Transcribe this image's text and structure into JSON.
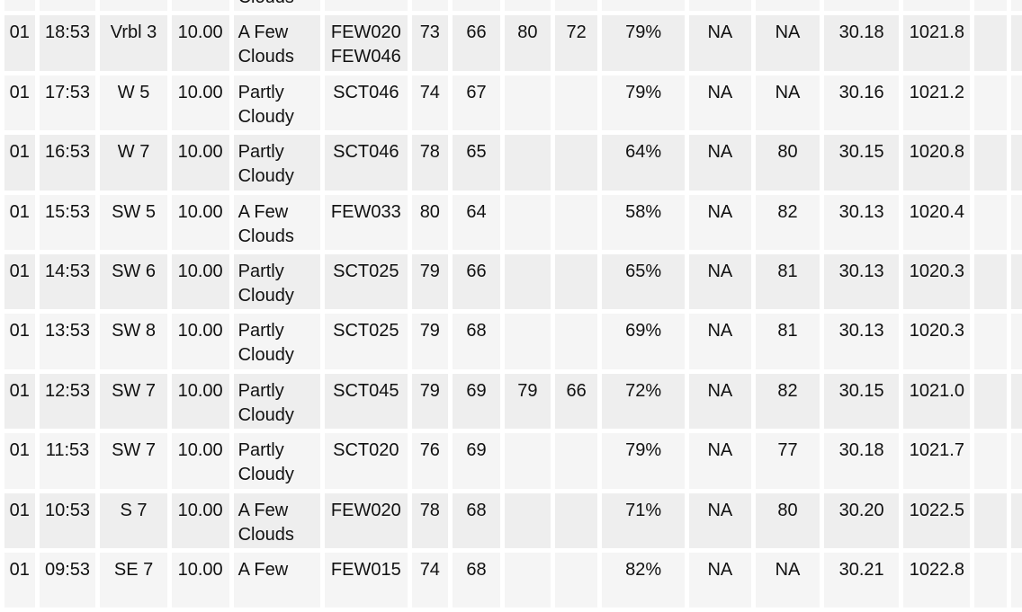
{
  "rows": [
    {
      "date": "",
      "time": "",
      "wind": "",
      "vis": "",
      "weather": "Clouds",
      "sky": "",
      "temp": "",
      "dew": "",
      "max6": "",
      "min6": "",
      "humidity": "",
      "windchill": "",
      "heatindex": "",
      "altimeter": "",
      "slp": "",
      "partial_top": true
    },
    {
      "date": "01",
      "time": "18:53",
      "wind": "Vrbl 3",
      "vis": "10.00",
      "weather": "A Few Clouds",
      "sky": "FEW020 FEW046",
      "temp": "73",
      "dew": "66",
      "max6": "80",
      "min6": "72",
      "humidity": "79%",
      "windchill": "NA",
      "heatindex": "NA",
      "altimeter": "30.18",
      "slp": "1021.8"
    },
    {
      "date": "01",
      "time": "17:53",
      "wind": "W 5",
      "vis": "10.00",
      "weather": "Partly Cloudy",
      "sky": "SCT046",
      "temp": "74",
      "dew": "67",
      "max6": "",
      "min6": "",
      "humidity": "79%",
      "windchill": "NA",
      "heatindex": "NA",
      "altimeter": "30.16",
      "slp": "1021.2"
    },
    {
      "date": "01",
      "time": "16:53",
      "wind": "W 7",
      "vis": "10.00",
      "weather": "Partly Cloudy",
      "sky": "SCT046",
      "temp": "78",
      "dew": "65",
      "max6": "",
      "min6": "",
      "humidity": "64%",
      "windchill": "NA",
      "heatindex": "80",
      "altimeter": "30.15",
      "slp": "1020.8"
    },
    {
      "date": "01",
      "time": "15:53",
      "wind": "SW 5",
      "vis": "10.00",
      "weather": "A Few Clouds",
      "sky": "FEW033",
      "temp": "80",
      "dew": "64",
      "max6": "",
      "min6": "",
      "humidity": "58%",
      "windchill": "NA",
      "heatindex": "82",
      "altimeter": "30.13",
      "slp": "1020.4"
    },
    {
      "date": "01",
      "time": "14:53",
      "wind": "SW 6",
      "vis": "10.00",
      "weather": "Partly Cloudy",
      "sky": "SCT025",
      "temp": "79",
      "dew": "66",
      "max6": "",
      "min6": "",
      "humidity": "65%",
      "windchill": "NA",
      "heatindex": "81",
      "altimeter": "30.13",
      "slp": "1020.3"
    },
    {
      "date": "01",
      "time": "13:53",
      "wind": "SW 8",
      "vis": "10.00",
      "weather": "Partly Cloudy",
      "sky": "SCT025",
      "temp": "79",
      "dew": "68",
      "max6": "",
      "min6": "",
      "humidity": "69%",
      "windchill": "NA",
      "heatindex": "81",
      "altimeter": "30.13",
      "slp": "1020.3"
    },
    {
      "date": "01",
      "time": "12:53",
      "wind": "SW 7",
      "vis": "10.00",
      "weather": "Partly Cloudy",
      "sky": "SCT045",
      "temp": "79",
      "dew": "69",
      "max6": "79",
      "min6": "66",
      "humidity": "72%",
      "windchill": "NA",
      "heatindex": "82",
      "altimeter": "30.15",
      "slp": "1021.0"
    },
    {
      "date": "01",
      "time": "11:53",
      "wind": "SW 7",
      "vis": "10.00",
      "weather": "Partly Cloudy",
      "sky": "SCT020",
      "temp": "76",
      "dew": "69",
      "max6": "",
      "min6": "",
      "humidity": "79%",
      "windchill": "NA",
      "heatindex": "77",
      "altimeter": "30.18",
      "slp": "1021.7"
    },
    {
      "date": "01",
      "time": "10:53",
      "wind": "S 7",
      "vis": "10.00",
      "weather": "A Few Clouds",
      "sky": "FEW020",
      "temp": "78",
      "dew": "68",
      "max6": "",
      "min6": "",
      "humidity": "71%",
      "windchill": "NA",
      "heatindex": "80",
      "altimeter": "30.20",
      "slp": "1022.5"
    },
    {
      "date": "01",
      "time": "09:53",
      "wind": "SE 7",
      "vis": "10.00",
      "weather": "A Few",
      "sky": "FEW015",
      "temp": "74",
      "dew": "68",
      "max6": "",
      "min6": "",
      "humidity": "82%",
      "windchill": "NA",
      "heatindex": "NA",
      "altimeter": "30.21",
      "slp": "1022.8"
    }
  ]
}
